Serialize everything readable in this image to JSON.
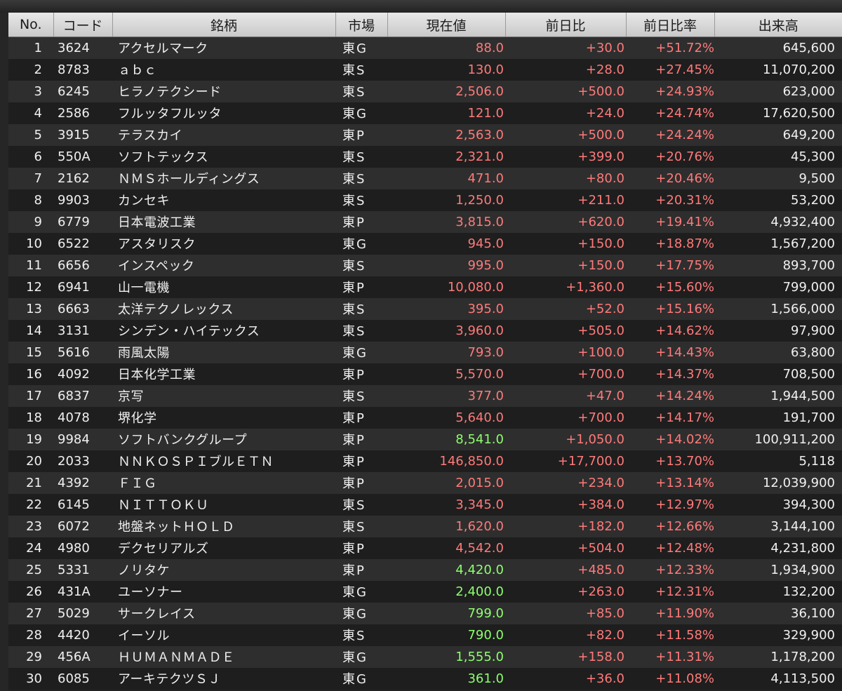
{
  "colors": {
    "up": "#ff7a7a",
    "highlight": "#8dff6e",
    "text": "#f0f0f0"
  },
  "columns": [
    "No.",
    "コード",
    "銘柄",
    "市場",
    "現在値",
    "前日比",
    "前日比率",
    "出来高"
  ],
  "rows": [
    {
      "no": "1",
      "code": "3624",
      "name": "アクセルマーク",
      "market": "東G",
      "price": "88.0",
      "change": "+30.0",
      "pct": "+51.72%",
      "volume": "645,600",
      "price_color": "#ff7a7a"
    },
    {
      "no": "2",
      "code": "8783",
      "name": "ａｂｃ",
      "market": "東S",
      "price": "130.0",
      "change": "+28.0",
      "pct": "+27.45%",
      "volume": "11,070,200",
      "price_color": "#ff7a7a"
    },
    {
      "no": "3",
      "code": "6245",
      "name": "ヒラノテクシード",
      "market": "東S",
      "price": "2,506.0",
      "change": "+500.0",
      "pct": "+24.93%",
      "volume": "623,000",
      "price_color": "#ff7a7a"
    },
    {
      "no": "4",
      "code": "2586",
      "name": "フルッタフルッタ",
      "market": "東G",
      "price": "121.0",
      "change": "+24.0",
      "pct": "+24.74%",
      "volume": "17,620,500",
      "price_color": "#ff7a7a"
    },
    {
      "no": "5",
      "code": "3915",
      "name": "テラスカイ",
      "market": "東P",
      "price": "2,563.0",
      "change": "+500.0",
      "pct": "+24.24%",
      "volume": "649,200",
      "price_color": "#ff7a7a"
    },
    {
      "no": "6",
      "code": "550A",
      "name": "ソフトテックス",
      "market": "東S",
      "price": "2,321.0",
      "change": "+399.0",
      "pct": "+20.76%",
      "volume": "45,300",
      "price_color": "#ff7a7a"
    },
    {
      "no": "7",
      "code": "2162",
      "name": "ＮＭＳホールディングス",
      "market": "東S",
      "price": "471.0",
      "change": "+80.0",
      "pct": "+20.46%",
      "volume": "9,500",
      "price_color": "#ff7a7a"
    },
    {
      "no": "8",
      "code": "9903",
      "name": "カンセキ",
      "market": "東S",
      "price": "1,250.0",
      "change": "+211.0",
      "pct": "+20.31%",
      "volume": "53,200",
      "price_color": "#ff7a7a"
    },
    {
      "no": "9",
      "code": "6779",
      "name": "日本電波工業",
      "market": "東P",
      "price": "3,815.0",
      "change": "+620.0",
      "pct": "+19.41%",
      "volume": "4,932,400",
      "price_color": "#ff7a7a"
    },
    {
      "no": "10",
      "code": "6522",
      "name": "アスタリスク",
      "market": "東G",
      "price": "945.0",
      "change": "+150.0",
      "pct": "+18.87%",
      "volume": "1,567,200",
      "price_color": "#ff7a7a"
    },
    {
      "no": "11",
      "code": "6656",
      "name": "インスペック",
      "market": "東S",
      "price": "995.0",
      "change": "+150.0",
      "pct": "+17.75%",
      "volume": "893,700",
      "price_color": "#ff7a7a"
    },
    {
      "no": "12",
      "code": "6941",
      "name": "山一電機",
      "market": "東P",
      "price": "10,080.0",
      "change": "+1,360.0",
      "pct": "+15.60%",
      "volume": "799,000",
      "price_color": "#ff7a7a"
    },
    {
      "no": "13",
      "code": "6663",
      "name": "太洋テクノレックス",
      "market": "東S",
      "price": "395.0",
      "change": "+52.0",
      "pct": "+15.16%",
      "volume": "1,566,000",
      "price_color": "#ff7a7a"
    },
    {
      "no": "14",
      "code": "3131",
      "name": "シンデン・ハイテックス",
      "market": "東S",
      "price": "3,960.0",
      "change": "+505.0",
      "pct": "+14.62%",
      "volume": "97,900",
      "price_color": "#ff7a7a"
    },
    {
      "no": "15",
      "code": "5616",
      "name": "雨風太陽",
      "market": "東G",
      "price": "793.0",
      "change": "+100.0",
      "pct": "+14.43%",
      "volume": "63,800",
      "price_color": "#ff7a7a"
    },
    {
      "no": "16",
      "code": "4092",
      "name": "日本化学工業",
      "market": "東P",
      "price": "5,570.0",
      "change": "+700.0",
      "pct": "+14.37%",
      "volume": "708,500",
      "price_color": "#ff7a7a"
    },
    {
      "no": "17",
      "code": "6837",
      "name": "京写",
      "market": "東S",
      "price": "377.0",
      "change": "+47.0",
      "pct": "+14.24%",
      "volume": "1,944,500",
      "price_color": "#ff7a7a"
    },
    {
      "no": "18",
      "code": "4078",
      "name": "堺化学",
      "market": "東P",
      "price": "5,640.0",
      "change": "+700.0",
      "pct": "+14.17%",
      "volume": "191,700",
      "price_color": "#ff7a7a"
    },
    {
      "no": "19",
      "code": "9984",
      "name": "ソフトバンクグループ",
      "market": "東P",
      "price": "8,541.0",
      "change": "+1,050.0",
      "pct": "+14.02%",
      "volume": "100,911,200",
      "price_color": "#8dff6e"
    },
    {
      "no": "20",
      "code": "2033",
      "name": "ＮＮＫＯＳＰＩブルＥＴＮ",
      "market": "東P",
      "price": "146,850.0",
      "change": "+17,700.0",
      "pct": "+13.70%",
      "volume": "5,118",
      "price_color": "#ff7a7a"
    },
    {
      "no": "21",
      "code": "4392",
      "name": "ＦＩＧ",
      "market": "東P",
      "price": "2,015.0",
      "change": "+234.0",
      "pct": "+13.14%",
      "volume": "12,039,900",
      "price_color": "#ff7a7a"
    },
    {
      "no": "22",
      "code": "6145",
      "name": "ＮＩＴＴＯＫＵ",
      "market": "東S",
      "price": "3,345.0",
      "change": "+384.0",
      "pct": "+12.97%",
      "volume": "394,300",
      "price_color": "#ff7a7a"
    },
    {
      "no": "23",
      "code": "6072",
      "name": "地盤ネットＨＯＬＤ",
      "market": "東S",
      "price": "1,620.0",
      "change": "+182.0",
      "pct": "+12.66%",
      "volume": "3,144,100",
      "price_color": "#ff7a7a"
    },
    {
      "no": "24",
      "code": "4980",
      "name": "デクセリアルズ",
      "market": "東P",
      "price": "4,542.0",
      "change": "+504.0",
      "pct": "+12.48%",
      "volume": "4,231,800",
      "price_color": "#ff7a7a"
    },
    {
      "no": "25",
      "code": "5331",
      "name": "ノリタケ",
      "market": "東P",
      "price": "4,420.0",
      "change": "+485.0",
      "pct": "+12.33%",
      "volume": "1,934,900",
      "price_color": "#8dff6e"
    },
    {
      "no": "26",
      "code": "431A",
      "name": "ユーソナー",
      "market": "東G",
      "price": "2,400.0",
      "change": "+263.0",
      "pct": "+12.31%",
      "volume": "132,200",
      "price_color": "#8dff6e"
    },
    {
      "no": "27",
      "code": "5029",
      "name": "サークレイス",
      "market": "東G",
      "price": "799.0",
      "change": "+85.0",
      "pct": "+11.90%",
      "volume": "36,100",
      "price_color": "#8dff6e"
    },
    {
      "no": "28",
      "code": "4420",
      "name": "イーソル",
      "market": "東S",
      "price": "790.0",
      "change": "+82.0",
      "pct": "+11.58%",
      "volume": "329,900",
      "price_color": "#8dff6e"
    },
    {
      "no": "29",
      "code": "456A",
      "name": "ＨＵＭＡＮＭＡＤＥ",
      "market": "東G",
      "price": "1,555.0",
      "change": "+158.0",
      "pct": "+11.31%",
      "volume": "1,178,200",
      "price_color": "#8dff6e"
    },
    {
      "no": "30",
      "code": "6085",
      "name": "アーキテクツＳＪ",
      "market": "東G",
      "price": "361.0",
      "change": "+36.0",
      "pct": "+11.08%",
      "volume": "4,113,500",
      "price_color": "#8dff6e"
    }
  ]
}
